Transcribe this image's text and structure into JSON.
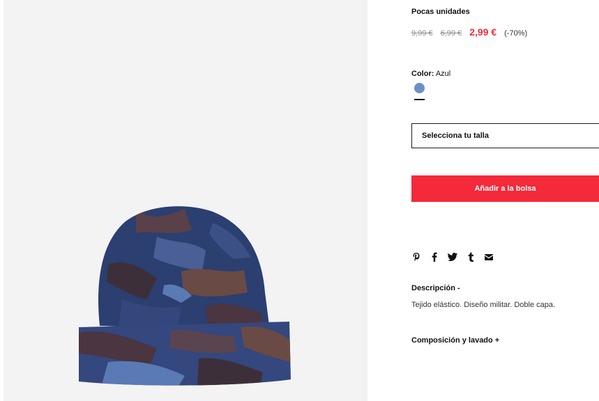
{
  "product": {
    "stock_status": "Pocas unidades",
    "price_original": "9,99 €",
    "price_previous": "6,99 €",
    "price_current": "2,99 €",
    "discount": "(-70%)",
    "color_label": "Color:",
    "color_value": "Azul",
    "color_swatch": "#6f8fc4",
    "size_placeholder": "Selecciona tu talla",
    "add_to_bag": "Añadir a la bolsa"
  },
  "share": {
    "icons": [
      "pinterest-icon",
      "facebook-icon",
      "twitter-icon",
      "tumblr-icon",
      "mail-icon"
    ]
  },
  "description": {
    "heading": "Descripción -",
    "text": "Tejido elástico. Diseño militar. Doble capa."
  },
  "composition": {
    "heading": "Composición y lavado +"
  },
  "colors": {
    "accent": "#f42a3a",
    "sale_price": "#f22a3a"
  }
}
